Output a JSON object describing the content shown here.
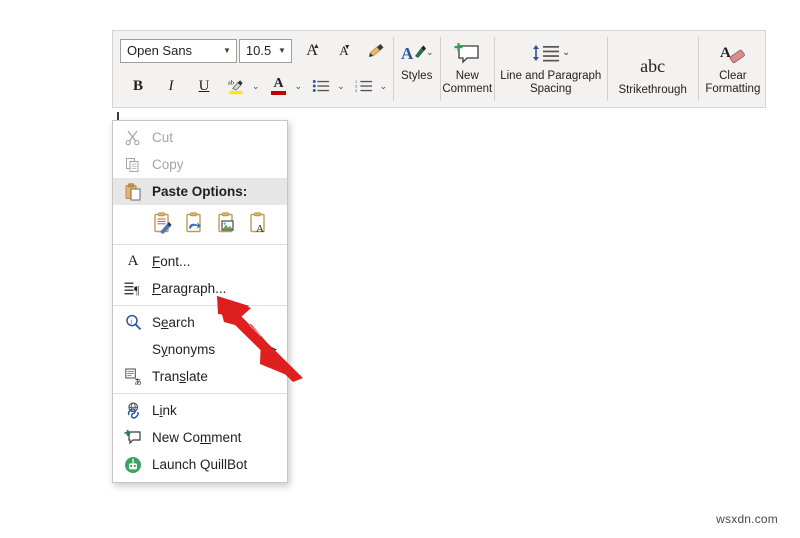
{
  "toolbar": {
    "font_name": "Open Sans",
    "font_size": "10.5",
    "grow_font_label": "A",
    "shrink_font_label": "A",
    "format_painter_name": "format-painter",
    "bold_label": "B",
    "italic_label": "I",
    "underline_label": "U",
    "highlight_label": "ab",
    "font_color_label": "A",
    "buttons": [
      {
        "label": "Styles",
        "icon": "styles-icon",
        "has_dropdown": true
      },
      {
        "label": "New\nComment",
        "label_line1": "New",
        "label_line2": "Comment",
        "icon": "new-comment-icon",
        "has_dropdown": false
      },
      {
        "label": "Line and Paragraph Spacing",
        "label_line1": "Line and Paragraph",
        "label_line2": "Spacing",
        "icon": "line-spacing-icon",
        "has_dropdown": true
      },
      {
        "label": "Strikethrough",
        "label_line1": "Strikethrough",
        "icon": "strikethrough-icon",
        "glyph": "abc",
        "has_dropdown": false
      },
      {
        "label": "Clear Formatting",
        "label_line1": "Clear",
        "label_line2": "Formatting",
        "icon": "clear-formatting-icon",
        "has_dropdown": false
      }
    ]
  },
  "context_menu": {
    "items": [
      {
        "label": "Cut",
        "icon": "scissors-icon",
        "disabled": true,
        "accel_index": 2
      },
      {
        "label": "Copy",
        "icon": "copy-icon",
        "disabled": true,
        "accel_index": 0
      },
      {
        "label": "Paste Options:",
        "icon": "paste-icon",
        "header": true
      },
      {
        "label": "Font...",
        "icon": "font-a-icon",
        "accel_index": 0
      },
      {
        "label": "Paragraph...",
        "icon": "paragraph-icon",
        "accel_index": 0
      },
      {
        "label": "Search",
        "icon": "search-icon",
        "accel_index": 1
      },
      {
        "label": "Synonyms",
        "icon": "none",
        "accel_index": 1,
        "submenu": true
      },
      {
        "label": "Translate",
        "icon": "translate-icon",
        "accel_index": 4
      },
      {
        "label": "Link",
        "icon": "link-icon",
        "accel_index": 1
      },
      {
        "label": "New Comment",
        "icon": "comment-icon",
        "accel_index": 6
      },
      {
        "label": "Launch QuillBot",
        "icon": "quillbot-icon"
      }
    ],
    "paste_options": [
      {
        "name": "keep-source-formatting"
      },
      {
        "name": "merge-formatting"
      },
      {
        "name": "picture"
      },
      {
        "name": "keep-text-only"
      }
    ]
  },
  "annotation": {
    "arrow_color": "#DE1F1F",
    "arrow_points_to": "Paragraph..."
  },
  "watermark": {
    "text": "wsxdn.com"
  },
  "colors": {
    "toolbar_bg": "#f3f2f1",
    "menu_bg": "#ffffff",
    "highlight_bg": "#e6e6e6",
    "accent_blue": "#2b579a",
    "red": "#c00000",
    "green": "#3aa35f",
    "yellow": "#ffe500"
  }
}
